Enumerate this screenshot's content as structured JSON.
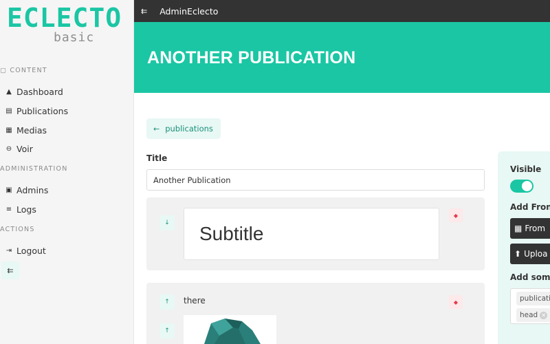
{
  "sidebar": {
    "logo_main": "ECLECTO",
    "logo_sub": "basic",
    "content_title": "CONTENT",
    "administration_title": "ADMINISTRATION",
    "actions_title": "ACTIONS",
    "items": [
      {
        "label": "Dashboard",
        "icon": "rocket-icon"
      },
      {
        "label": "Publications",
        "icon": "document-icon"
      },
      {
        "label": "Medias",
        "icon": "images-icon"
      },
      {
        "label": "Voir",
        "icon": "eye-icon"
      },
      {
        "label": "Admins",
        "icon": "user-card-icon"
      },
      {
        "label": "Logs",
        "icon": "filter-icon"
      },
      {
        "label": "Logout",
        "icon": "logout-icon"
      }
    ]
  },
  "topbar": {
    "brand": "AdminEclecto"
  },
  "banner": {
    "title": "ANOTHER PUBLICATION"
  },
  "main": {
    "back_label": "publications",
    "title_label": "Title",
    "title_value": "Another Publication",
    "block1_text": "Subtitle",
    "block2_text": "there"
  },
  "panel": {
    "visible_label": "Visible",
    "visible_on": true,
    "add_front_label": "Add Front",
    "from_button": "From",
    "upload_button": "Uploa",
    "add_some_label": "Add some",
    "tags": [
      "publicatio",
      "head"
    ]
  },
  "colors": {
    "accent": "#1bc6a4",
    "topbar": "#333333",
    "danger": "#e03a4e"
  }
}
